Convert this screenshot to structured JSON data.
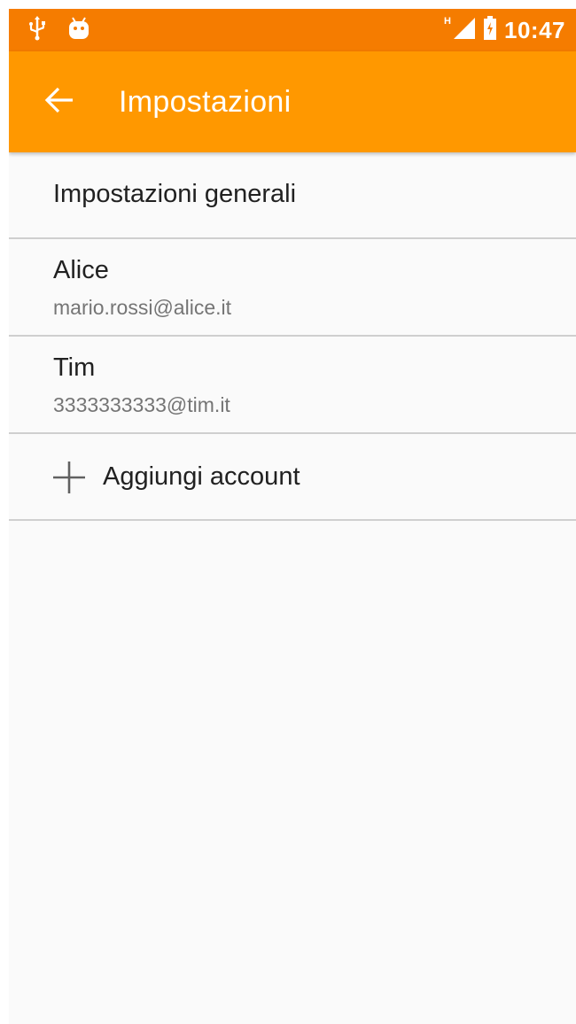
{
  "status_bar": {
    "time": "10:47",
    "network_type": "H",
    "icons": [
      "usb-icon",
      "android-icon",
      "signal-icon",
      "battery-icon"
    ]
  },
  "app_bar": {
    "title": "Impostazioni",
    "back_icon": "arrow-left-icon"
  },
  "settings": {
    "general": {
      "label": "Impostazioni generali"
    },
    "accounts": [
      {
        "name": "Alice",
        "email": "mario.rossi@alice.it"
      },
      {
        "name": "Tim",
        "email": "3333333333@tim.it"
      }
    ],
    "add_account": {
      "label": "Aggiungi account",
      "icon": "plus-icon"
    }
  },
  "colors": {
    "status_bar": "#f57c00",
    "app_bar": "#ff9800",
    "background": "#fafafa",
    "divider": "#cfcfcf",
    "primary_text": "#212121",
    "secondary_text": "#757575"
  }
}
